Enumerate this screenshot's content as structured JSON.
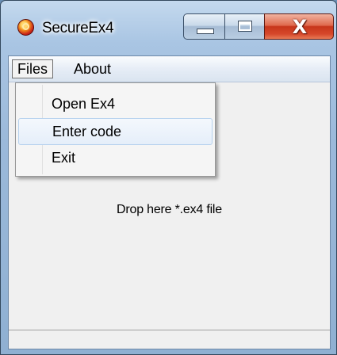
{
  "window": {
    "title": "SecureEx4",
    "icon": "app-icon"
  },
  "menubar": {
    "items": [
      {
        "label": "Files",
        "open": true
      },
      {
        "label": "About"
      }
    ]
  },
  "files_menu": {
    "items": [
      {
        "label": "Open Ex4"
      },
      {
        "label": "Enter code",
        "highlighted": true
      },
      {
        "label": "Exit"
      }
    ]
  },
  "main": {
    "drop_hint": "Drop here *.ex4 file"
  },
  "caption_buttons": {
    "minimize_icon": "minimize-icon",
    "maximize_icon": "maximize-icon",
    "close_icon": "close-icon",
    "close_glyph": "X"
  },
  "colors": {
    "close_red": "#c7361b",
    "menu_highlight": "#e5eef9"
  }
}
